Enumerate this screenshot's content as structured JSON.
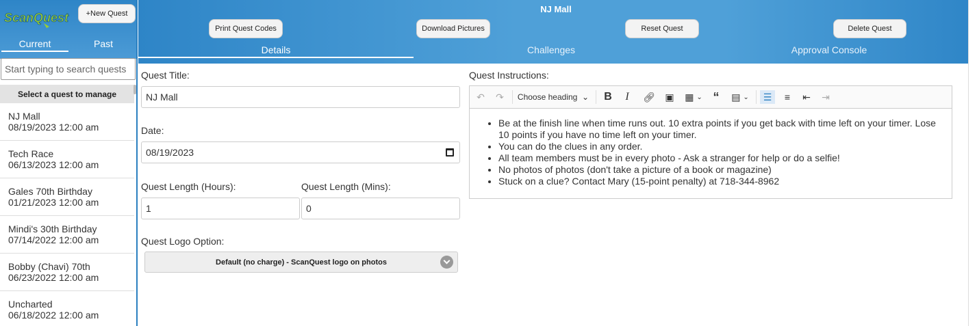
{
  "sidebar": {
    "logo_text": "ScanQuest",
    "new_quest_label": "+New Quest",
    "tabs": {
      "current": "Current",
      "past": "Past"
    },
    "search_placeholder": "Start typing to search quests",
    "list_header": "Select a quest to manage",
    "quests": [
      {
        "name": "NJ Mall",
        "date": "08/19/2023 12:00 am"
      },
      {
        "name": "Tech Race",
        "date": "06/13/2023 12:00 am"
      },
      {
        "name": "Gales 70th Birthday",
        "date": "01/21/2023 12:00 am"
      },
      {
        "name": "Mindi's 30th Birthday",
        "date": "07/14/2022 12:00 am"
      },
      {
        "name": "Bobby (Chavi) 70th",
        "date": "06/23/2022 12:00 am"
      },
      {
        "name": "Uncharted",
        "date": "06/18/2022 12:00 am"
      }
    ]
  },
  "header": {
    "quest_name": "NJ Mall",
    "buttons": {
      "print": "Print Quest Codes",
      "download": "Download Pictures",
      "reset": "Reset Quest",
      "delete": "Delete Quest"
    },
    "tabs": {
      "details": "Details",
      "challenges": "Challenges",
      "approval": "Approval Console"
    }
  },
  "details": {
    "title_label": "Quest Title:",
    "title_value": "NJ Mall",
    "date_label": "Date:",
    "date_value": "08/19/2023",
    "hours_label": "Quest Length (Hours):",
    "hours_value": "1",
    "mins_label": "Quest Length (Mins):",
    "mins_value": "0",
    "logo_label": "Quest Logo Option:",
    "logo_value": "Default (no charge) - ScanQuest logo on photos"
  },
  "instructions": {
    "label": "Quest Instructions:",
    "heading_dropdown": "Choose heading",
    "items": [
      "Be at the finish line when time runs out.  10 extra points if you get back with time left on your timer.  Lose 10 points if you have no time left on your timer.",
      "You can do the clues in any order.",
      "All team members must be in every photo - Ask a stranger for help or do a selfie!",
      "No photos of photos (don't take a picture of a book or magazine)",
      "Stuck on a clue?  Contact Mary (15-point penalty) at 718-344-8962"
    ]
  },
  "colors": {
    "header_blue": "#2e85c7",
    "header_light": "#4fa0d8"
  }
}
